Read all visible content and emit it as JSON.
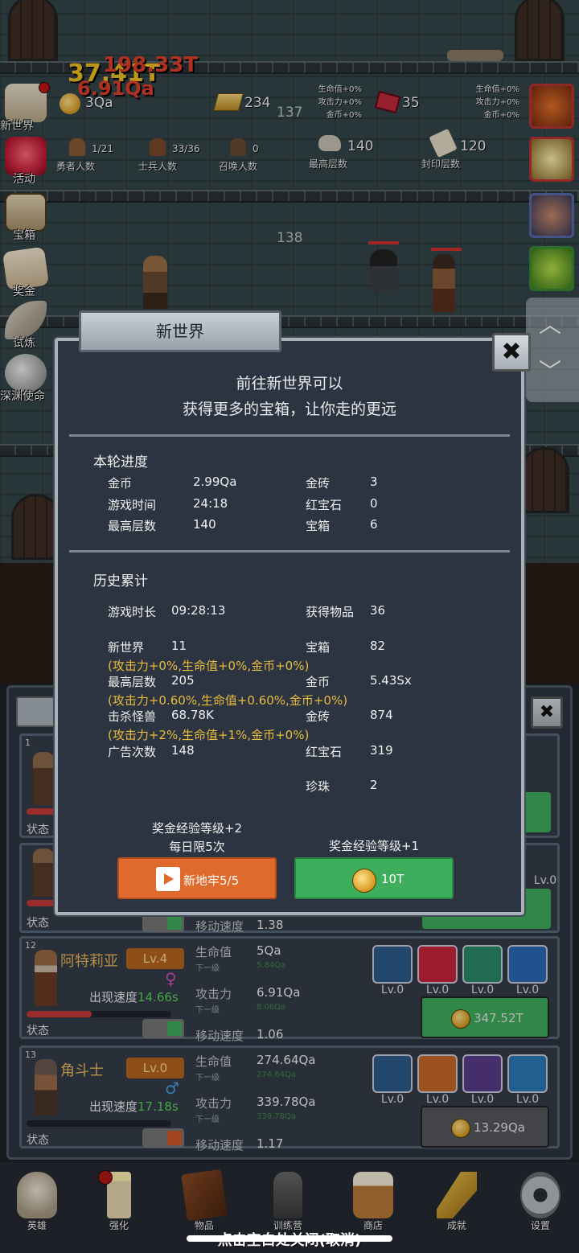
{
  "hud": {
    "gold": "3Qa",
    "gold_bar": "234",
    "ruby": "35",
    "floor_top": "137",
    "floor_mid": "138",
    "damage_1": "37.41T",
    "damage_2": "6.91Qa",
    "damage_3": "198.33T",
    "heroes": {
      "value": "1/21",
      "label": "勇者人数"
    },
    "soldiers": {
      "value": "33/36",
      "label": "士兵人数"
    },
    "summons": {
      "value": "0",
      "label": "召唤人数"
    },
    "highest": {
      "value": "140",
      "label": "最高层数"
    },
    "seal": {
      "value": "120",
      "label": "封印层数"
    },
    "bonus_left": [
      "生命值+0%",
      "攻击力+0%",
      "金币+0%"
    ],
    "bonus_right": [
      "生命值+0%",
      "攻击力+0%",
      "金币+0%"
    ]
  },
  "side_menu": [
    "新世界",
    "活动",
    "宝箱",
    "奖金",
    "试炼",
    "深渊使命"
  ],
  "modal": {
    "title": "新世界",
    "close_icon": "✖",
    "intro_line1": "前往新世界可以",
    "intro_line2": "获得更多的宝箱，让你走的更远",
    "round_title": "本轮进度",
    "round": [
      {
        "k": "金币",
        "v": "2.99Qa"
      },
      {
        "k": "游戏时间",
        "v": "24:18"
      },
      {
        "k": "最高层数",
        "v": "140"
      },
      {
        "k": "金砖",
        "v": "3"
      },
      {
        "k": "红宝石",
        "v": "0"
      },
      {
        "k": "宝箱",
        "v": "6"
      }
    ],
    "history_title": "历史累计",
    "history": {
      "play_time": {
        "k": "游戏时长",
        "v": "09:28:13"
      },
      "new_world": {
        "k": "新世界",
        "v": "11"
      },
      "new_world_bonus": "(攻击力+0%,生命值+0%,金币+0%)",
      "highest": {
        "k": "最高层数",
        "v": "205"
      },
      "highest_bonus": "(攻击力+0.60%,生命值+0.60%,金币+0%)",
      "kills": {
        "k": "击杀怪兽",
        "v": "68.78K"
      },
      "kills_bonus": "(攻击力+2%,生命值+1%,金币+0%)",
      "ads": {
        "k": "广告次数",
        "v": "148"
      },
      "items": {
        "k": "获得物品",
        "v": "36"
      },
      "chests": {
        "k": "宝箱",
        "v": "82"
      },
      "gold": {
        "k": "金币",
        "v": "5.43Sx"
      },
      "gold_bars": {
        "k": "金砖",
        "v": "874"
      },
      "rubies": {
        "k": "红宝石",
        "v": "319"
      },
      "pearls": {
        "k": "珍珠",
        "v": "2"
      }
    },
    "left_note1": "奖金经验等级+2",
    "left_note2": "每日限5次",
    "right_note": "奖金经验等级+1",
    "btn_dungeon": "新地牢5/5",
    "btn_gold": "10T"
  },
  "cards": [
    {
      "num": "12",
      "name": "阿特莉亚",
      "lv": "Lv.4",
      "gender": "♀",
      "gender_color": "#d24fc0",
      "speed_label": "出现速度",
      "speed": "14.66s",
      "hp_fill": 0.45,
      "toggle_color": "#3fae5c",
      "state": "状态",
      "hp_label": "生命值",
      "hp": "5Qa",
      "hp_next": "5.84Qa",
      "atk_label": "攻击力",
      "atk": "6.91Qa",
      "atk_next": "8.06Qa",
      "next_label": "下一级",
      "move_label": "移动速度",
      "move": "1.06",
      "skill_lv": [
        "Lv.0",
        "Lv.0",
        "Lv.0",
        "Lv.0"
      ],
      "price": "347.52T",
      "price_bg": "#3fae5c"
    },
    {
      "num": "13",
      "name": "角斗士",
      "lv": "Lv.0",
      "gender": "♂",
      "gender_color": "#4aa0e0",
      "speed_label": "出现速度",
      "speed": "17.18s",
      "hp_fill": 0.0,
      "toggle_color": "#d0582a",
      "state": "状态",
      "hp_label": "生命值",
      "hp": "274.64Qa",
      "hp_next": "274.64Qa",
      "atk_label": "攻击力",
      "atk": "339.78Qa",
      "atk_next": "339.78Qa",
      "next_label": "下一级",
      "move_label": "移动速度",
      "move": "1.17",
      "skill_lv": [
        "Lv.0",
        "Lv.0",
        "Lv.0",
        "Lv.0"
      ],
      "price": "13.29Qa",
      "price_bg": "#55585c"
    }
  ],
  "partial_cards": {
    "c1_num": "1",
    "c1_state": "状态",
    "c2_state": "状态",
    "c2_move_label": "移动速度",
    "c2_move": "1.38",
    "c2_lv": "Lv.0"
  },
  "nav": [
    "英雄",
    "强化",
    "物品",
    "训练营",
    "商店",
    "成就",
    "设置"
  ],
  "close_hint": "点击空白处关闭(取消)"
}
